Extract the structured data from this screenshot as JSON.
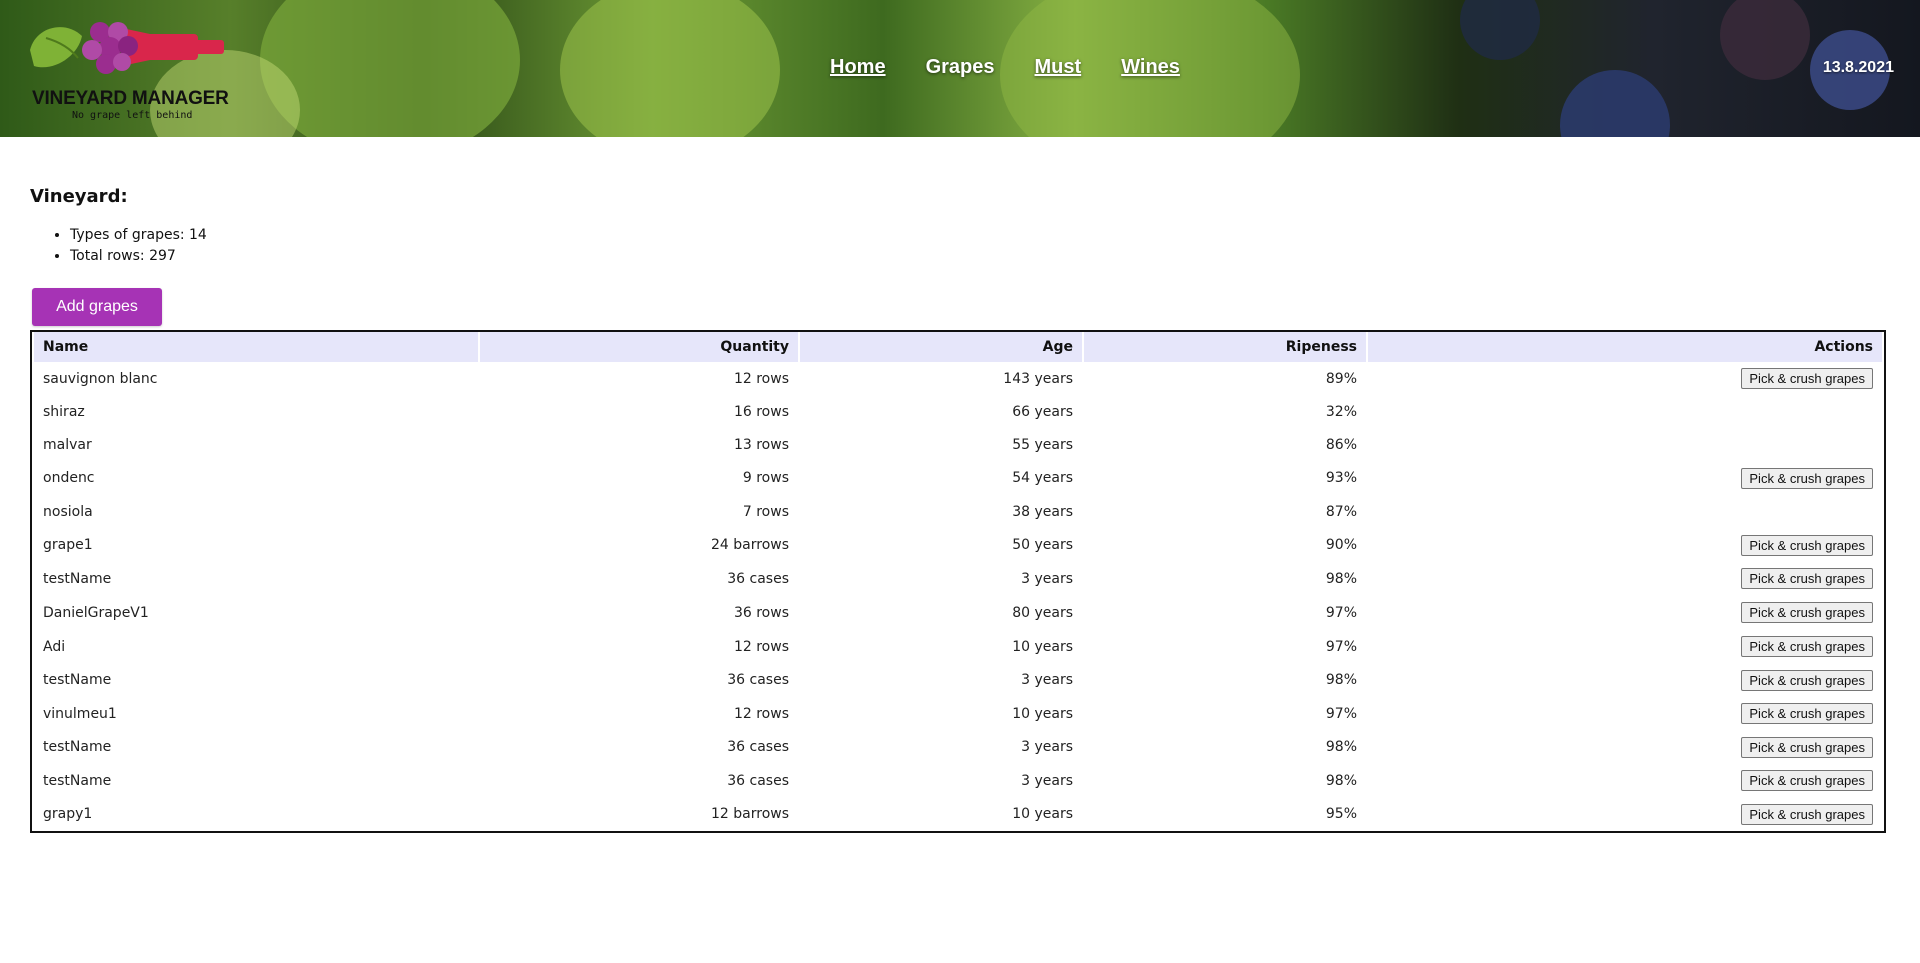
{
  "brand": {
    "title": "VINEYARD MANAGER",
    "tagline": "No grape left behind",
    "colors": {
      "grape": "#9b2d8f",
      "bottle": "#d9264b",
      "leaf": "#7fb236"
    }
  },
  "nav": {
    "items": [
      {
        "label": "Home"
      },
      {
        "label": "Grapes"
      },
      {
        "label": "Must"
      },
      {
        "label": "Wines"
      }
    ],
    "current": "Grapes"
  },
  "date": "13.8.2021",
  "vineyard": {
    "title": "Vineyard:",
    "stats": [
      "Types of grapes: 14",
      "Total rows: 297"
    ],
    "add_button": "Add grapes"
  },
  "table": {
    "headers": {
      "name": "Name",
      "quantity": "Quantity",
      "age": "Age",
      "ripeness": "Ripeness",
      "actions": "Actions"
    },
    "action_label": "Pick & crush grapes",
    "rows": [
      {
        "name": "sauvignon blanc",
        "quantity": "12 rows",
        "age": "143 years",
        "ripeness": "89%",
        "action": true
      },
      {
        "name": "shiraz",
        "quantity": "16 rows",
        "age": "66 years",
        "ripeness": "32%",
        "action": false
      },
      {
        "name": "malvar",
        "quantity": "13 rows",
        "age": "55 years",
        "ripeness": "86%",
        "action": false
      },
      {
        "name": "ondenc",
        "quantity": "9 rows",
        "age": "54 years",
        "ripeness": "93%",
        "action": true
      },
      {
        "name": "nosiola",
        "quantity": "7 rows",
        "age": "38 years",
        "ripeness": "87%",
        "action": false
      },
      {
        "name": "grape1",
        "quantity": "24 barrows",
        "age": "50 years",
        "ripeness": "90%",
        "action": true
      },
      {
        "name": "testName",
        "quantity": "36 cases",
        "age": "3 years",
        "ripeness": "98%",
        "action": true
      },
      {
        "name": "DanielGrapeV1",
        "quantity": "36 rows",
        "age": "80 years",
        "ripeness": "97%",
        "action": true
      },
      {
        "name": "Adi",
        "quantity": "12 rows",
        "age": "10 years",
        "ripeness": "97%",
        "action": true
      },
      {
        "name": "testName",
        "quantity": "36 cases",
        "age": "3 years",
        "ripeness": "98%",
        "action": true
      },
      {
        "name": "vinulmeu1",
        "quantity": "12 rows",
        "age": "10 years",
        "ripeness": "97%",
        "action": true
      },
      {
        "name": "testName",
        "quantity": "36 cases",
        "age": "3 years",
        "ripeness": "98%",
        "action": true
      },
      {
        "name": "testName",
        "quantity": "36 cases",
        "age": "3 years",
        "ripeness": "98%",
        "action": true
      },
      {
        "name": "grapy1",
        "quantity": "12 barrows",
        "age": "10 years",
        "ripeness": "95%",
        "action": true
      }
    ]
  }
}
